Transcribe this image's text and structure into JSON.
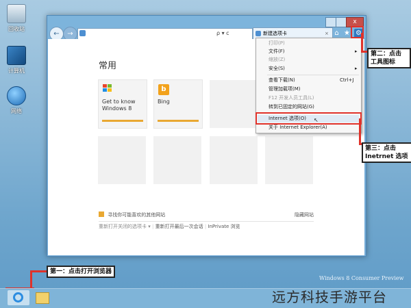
{
  "desktop": {
    "icons": [
      {
        "label": "回收站",
        "name": "recycle-bin-icon"
      },
      {
        "label": "计算机",
        "name": "computer-icon"
      },
      {
        "label": "网络",
        "name": "network-icon"
      }
    ],
    "watermark_text": "Windows 8 Consumer Preview"
  },
  "browser": {
    "address_value": "",
    "address_icons": "ρ ▾ c",
    "tab_title": "新建选项卡",
    "tab_close": "×",
    "close_glyph": "x",
    "back_glyph": "←",
    "forward_glyph": "→",
    "home_glyph": "⌂",
    "fav_glyph": "★",
    "tools_glyph": "⚙"
  },
  "newtab": {
    "heading": "常用",
    "tiles": [
      {
        "label": "Get to know Windows 8",
        "label_line1": "Get to know",
        "label_line2": "Windows 8",
        "icon": "windows-flag-icon"
      },
      {
        "label": "Bing",
        "icon": "bing-icon"
      }
    ],
    "suggest_text": "寻找你可能喜欢的其他网站",
    "hide_sites": "隐藏网站",
    "reopen_closed": "重新打开关闭的选项卡 ▾",
    "reopen_session": "重新打开最后一次会话",
    "inprivate": "InPrivate 浏览"
  },
  "tools_menu": {
    "items": [
      {
        "label": "打印(P)",
        "dim": true
      },
      {
        "label": "文件(F)",
        "submenu": true
      },
      {
        "label": "缩放(Z)",
        "dim": true
      },
      {
        "label": "安全(S)",
        "submenu": true
      },
      {
        "label": "查看下载(N)",
        "shortcut": "Ctrl+J"
      },
      {
        "label": "管理加载项(M)"
      },
      {
        "label": "F12 开发人员工具(L)",
        "dim": true
      },
      {
        "label": "转到已固定的网站(G)"
      },
      {
        "label": "Internet 选项(O)",
        "highlight": true
      },
      {
        "label": "关于 Internet Explorer(A)"
      }
    ]
  },
  "callouts": {
    "step1": "第一：点击打开浏览器",
    "step2_line1": "第二：点击",
    "step2_line2": "工具图标",
    "step3_line1": "第三：点击",
    "step3_line2": "Inetrnet 选项"
  },
  "brand_watermark": "远方科技手游平台",
  "colors": {
    "accent_red": "#e0322a",
    "progress_orange": "#e9a832",
    "window_blue": "#78aed8"
  }
}
